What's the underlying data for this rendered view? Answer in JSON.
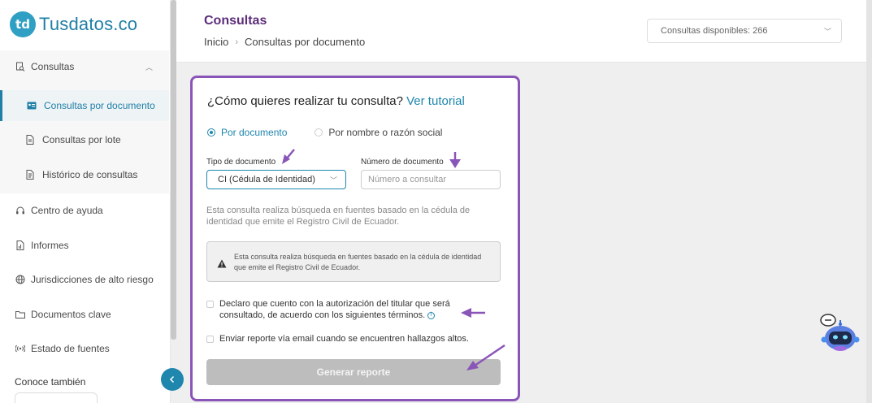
{
  "brand": {
    "logo_mark": "td",
    "name": "Tusdatos.co"
  },
  "sidebar": {
    "items": [
      {
        "label": "Consultas",
        "icon": "search-doc-icon"
      },
      {
        "label": "Consultas por documento",
        "icon": "id-card-icon"
      },
      {
        "label": "Consultas por lote",
        "icon": "file-icon"
      },
      {
        "label": "Histórico de consultas",
        "icon": "history-icon"
      },
      {
        "label": "Centro de ayuda",
        "icon": "headset-icon"
      },
      {
        "label": "Informes",
        "icon": "report-icon"
      },
      {
        "label": "Jurisdicciones de alto riesgo",
        "icon": "globe-icon"
      },
      {
        "label": "Documentos clave",
        "icon": "folder-icon"
      },
      {
        "label": "Estado de fuentes",
        "icon": "signal-icon"
      }
    ],
    "conoce": "Conoce también"
  },
  "header": {
    "title": "Consultas",
    "breadcrumb": [
      "Inicio",
      "Consultas por documento"
    ],
    "available": "Consultas disponibles: 266"
  },
  "form": {
    "question": "¿Cómo quieres realizar tu consulta?",
    "tutorial_link": "Ver tutorial",
    "radio_by_document": "Por documento",
    "radio_by_name": "Por nombre o razón social",
    "doc_type_label": "Tipo de documento",
    "doc_type_value": "CI (Cédula de Identidad)",
    "doc_number_label": "Número de documento",
    "doc_number_placeholder": "Número a consultar",
    "description": "Esta consulta realiza búsqueda en fuentes basado en la cédula de identidad que emite el Registro Civil de Ecuador.",
    "warning": "Esta consulta realiza búsqueda en fuentes basado en la cédula de identidad que emite el Registro Civil de Ecuador.",
    "consent_line1": "Declaro que cuento con la autorización del titular que será",
    "consent_line2": "consultado, de acuerdo con los siguientes términos.",
    "email_report": "Enviar reporte vía email cuando se encuentren hallazgos altos.",
    "generate_button": "Generar reporte"
  },
  "colors": {
    "accent": "#1f86ad",
    "title_purple": "#5c2d7a",
    "card_border": "#8a55b8",
    "arrow": "#8a55b8",
    "disabled_button": "#bdbdbd"
  }
}
